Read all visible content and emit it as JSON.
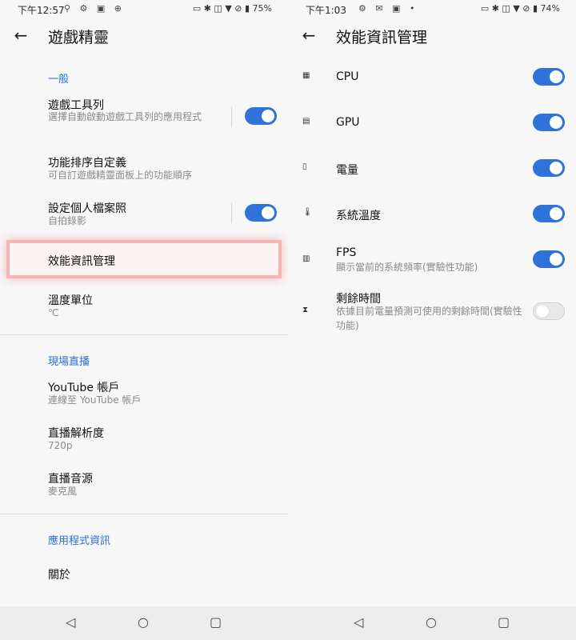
{
  "left": {
    "status": {
      "time": "下午12:57",
      "battery": "75%"
    },
    "title": "遊戲精靈",
    "sections": {
      "general": "一般",
      "live": "現場直播",
      "app_info": "應用程式資訊"
    },
    "items": [
      {
        "title": "遊戲工具列",
        "subtitle": "選擇自動啟動遊戲工具列的應用程式"
      },
      {
        "title": "功能排序自定義",
        "subtitle": "可自訂遊戲精靈面板上的功能順序"
      },
      {
        "title": "設定個人檔案照",
        "subtitle": "自拍錄影"
      },
      {
        "title": "效能資訊管理",
        "subtitle": ""
      },
      {
        "title": "溫度單位",
        "subtitle": "℃"
      },
      {
        "title": "YouTube 帳戶",
        "subtitle": "連線至 YouTube 帳戶"
      },
      {
        "title": "直播解析度",
        "subtitle": "720p"
      },
      {
        "title": "直播音源",
        "subtitle": "麥克風"
      },
      {
        "title": "關於",
        "subtitle": ""
      }
    ]
  },
  "right": {
    "status": {
      "time": "下午1:03",
      "battery": "74%"
    },
    "title": "效能資訊管理",
    "items": [
      {
        "title": "CPU",
        "subtitle": "",
        "icon": "cpu-icon",
        "enabled": true
      },
      {
        "title": "GPU",
        "subtitle": "",
        "icon": "gpu-icon",
        "enabled": true
      },
      {
        "title": "電量",
        "subtitle": "",
        "icon": "battery-icon",
        "enabled": true
      },
      {
        "title": "系統溫度",
        "subtitle": "",
        "icon": "thermometer-icon",
        "enabled": true
      },
      {
        "title": "FPS",
        "subtitle": "顯示當前的系統頻率(實驗性功能)",
        "icon": "fps-icon",
        "enabled": true
      },
      {
        "title": "剩餘時間",
        "subtitle": "依據目前電量預測可使用的剩餘時間(實驗性功能)",
        "icon": "hourglass-icon",
        "enabled": false
      }
    ]
  },
  "colors": {
    "accent": "#2f73da",
    "highlight": "#f5b4b4",
    "background": "#f7f7f7"
  }
}
